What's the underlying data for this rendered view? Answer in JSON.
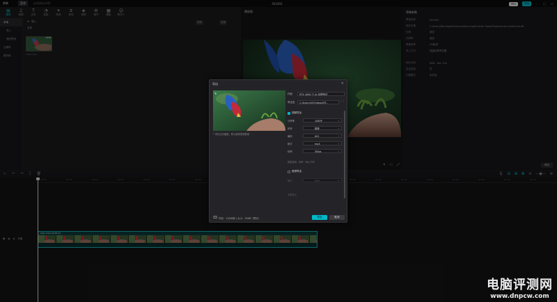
{
  "app": {
    "logo_text": "剪映",
    "menu_label": "菜单",
    "project_hint": "自动保存本地：",
    "window_title": "452402",
    "pro_label": "PRO",
    "export_label": "导出"
  },
  "toolbar": {
    "tabs": [
      {
        "label": "媒体",
        "icon": "▤"
      },
      {
        "label": "音频",
        "icon": "♫"
      },
      {
        "label": "文本",
        "icon": "T"
      },
      {
        "label": "贴纸",
        "icon": "◔"
      },
      {
        "label": "特效",
        "icon": "✦"
      },
      {
        "label": "转场",
        "icon": "⧖"
      },
      {
        "label": "滤镜",
        "icon": "◈"
      },
      {
        "label": "调节",
        "icon": "⚙"
      },
      {
        "label": "模板",
        "icon": "▦"
      },
      {
        "label": "数字人",
        "icon": "☺"
      }
    ]
  },
  "sidebar": {
    "items": [
      "本地",
      "导入",
      "我的预设",
      "云素材",
      "素材库"
    ]
  },
  "media": {
    "header": "导入",
    "sort_label": "排序",
    "filter_label": "全部",
    "sub_label": "全部",
    "thumb_duration": "00:08",
    "thumb_caption": "video.mp4"
  },
  "player": {
    "title": "播放器"
  },
  "props": {
    "title": "草稿参数",
    "rows": [
      {
        "k": "草稿名称",
        "v": "452402"
      },
      {
        "k": "保存位置",
        "v": "C:/Users/Win/AppData/Local/JianyingPro/User Data/Projects/com.lveditor.draft"
      },
      {
        "k": "比例",
        "v": "适应"
      },
      {
        "k": "分辨率",
        "v": "适应"
      },
      {
        "k": "草稿帧率",
        "v": "30帧/秒"
      },
      {
        "k": "导入方式",
        "v": "保留在原有位置"
      },
      {
        "k": "色彩空间",
        "v": "SDR - Rec.709"
      },
      {
        "k": "自由层级",
        "v": "关"
      },
      {
        "k": "代理模式",
        "v": "未开启"
      }
    ],
    "modify_label": "修改"
  },
  "timeline": {
    "ruler": [
      "00:00",
      "00:05",
      "00:10",
      "00:15",
      "00:20",
      "00:25",
      "00:30",
      "00:35",
      "00:40",
      "00:45",
      "00:50",
      "00:55",
      "01:00",
      "01:05",
      "01:10",
      "01:15",
      "01:20",
      "01:25",
      "01:30",
      "01:35"
    ],
    "track_label": "封面",
    "clip_label": "video.mp4  00:00:21"
  },
  "dialog": {
    "title": "导出",
    "cover_note": "* 未标注封面图，默认使用视频首帧",
    "name_label": "作品",
    "name_value": "RTX 4060 Ti AI 绘图测试",
    "path_label": "导出至",
    "path_value": "C:/Users/h5/Videos/RT...",
    "video_section": "视频导出",
    "video_rows": [
      {
        "k": "分辨率",
        "v": "1080P"
      },
      {
        "k": "码率",
        "v": "推荐"
      },
      {
        "k": "编码",
        "v": "AV1"
      },
      {
        "k": "格式",
        "v": "mp4"
      },
      {
        "k": "帧率",
        "v": "30fps"
      }
    ],
    "color_info": "色彩空间：SDR - Rec.709",
    "audio_section": "音频导出",
    "audio_rows": [
      {
        "k": "格式",
        "v": "MP3"
      }
    ],
    "subtitle_hint": "字幕导出",
    "footer_info": "时长：1分38秒 | 大小：196M（预计）",
    "export_button": "导出",
    "cancel_button": "取消"
  },
  "watermark": {
    "name": "电脑评测网",
    "url": "www.dnpcw.com"
  }
}
